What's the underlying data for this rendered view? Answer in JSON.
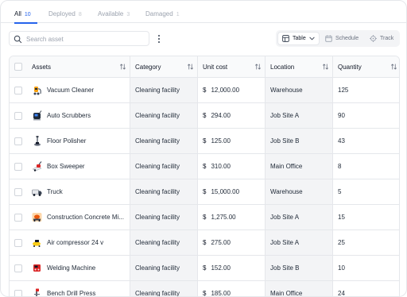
{
  "tabs": [
    {
      "label": "All",
      "count": "10"
    },
    {
      "label": "Deployed",
      "count": "8"
    },
    {
      "label": "Available",
      "count": "3"
    },
    {
      "label": "Damaged",
      "count": "1"
    }
  ],
  "search": {
    "placeholder": "Search asset"
  },
  "views": {
    "table": "Table",
    "schedule": "Schedule",
    "track": "Track"
  },
  "table": {
    "columns": [
      "Assets",
      "Category",
      "Unit cost",
      "Location",
      "Quantity"
    ],
    "currency": "$",
    "rows": [
      {
        "asset": "Vacuum Cleaner",
        "category": "Cleaning facility",
        "cost": "12,000.00",
        "location": "Warehouse",
        "qty": "125",
        "icon": "vacuum-icon"
      },
      {
        "asset": "Auto Scrubbers",
        "category": "Cleaning facility",
        "cost": "294.00",
        "location": "Job Site A",
        "qty": "90",
        "icon": "scrubber-icon"
      },
      {
        "asset": "Floor Polisher",
        "category": "Cleaning facility",
        "cost": "125.00",
        "location": "Job Site B",
        "qty": "43",
        "icon": "polisher-icon"
      },
      {
        "asset": "Box Sweeper",
        "category": "Cleaning facility",
        "cost": "310.00",
        "location": "Main Office",
        "qty": "8",
        "icon": "sweeper-icon"
      },
      {
        "asset": "Truck",
        "category": "Cleaning facility",
        "cost": "15,000.00",
        "location": "Warehouse",
        "qty": "5",
        "icon": "truck-icon"
      },
      {
        "asset": "Construction Concrete Mi...",
        "category": "Cleaning facility",
        "cost": "1,275.00",
        "location": "Job Site A",
        "qty": "15",
        "icon": "mixer-icon"
      },
      {
        "asset": "Air compressor 24 v",
        "category": "Cleaning facility",
        "cost": "275.00",
        "location": "Job Site A",
        "qty": "25",
        "icon": "compressor-icon"
      },
      {
        "asset": "Welding Machine",
        "category": "Cleaning facility",
        "cost": "152.00",
        "location": "Job Site B",
        "qty": "10",
        "icon": "welder-icon"
      },
      {
        "asset": "Bench Drill Press",
        "category": "Cleaning facility",
        "cost": "185.00",
        "location": "Main Office",
        "qty": "24",
        "icon": "drill-press-icon"
      }
    ]
  }
}
